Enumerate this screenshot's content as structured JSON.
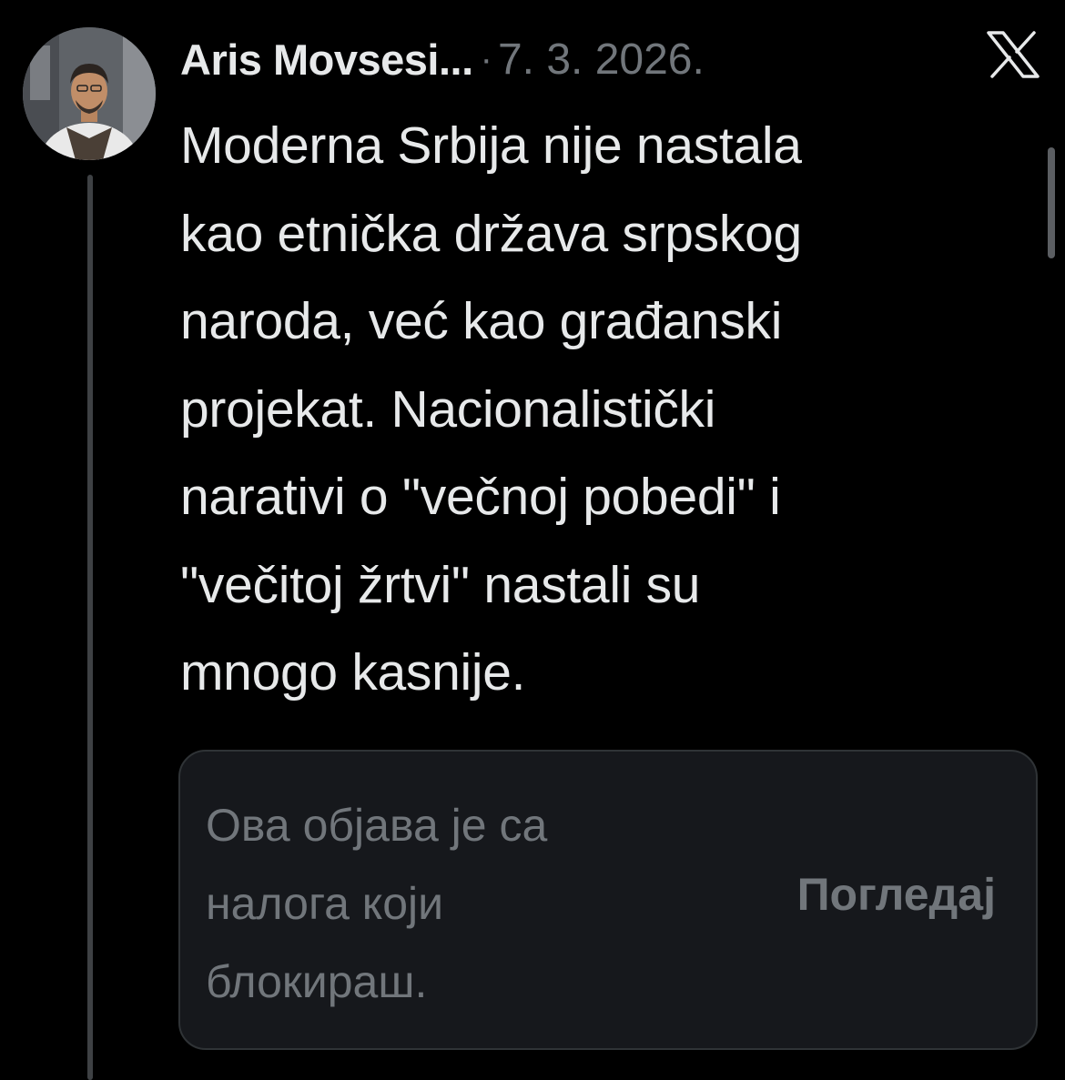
{
  "tweet": {
    "author": "Aris Movsesi...",
    "separator": "·",
    "date": "7. 3. 2026.",
    "text": "Moderna Srbija nije nastala\nkao etnička država srpskog\nnaroda, već kao građanski\nprojekat. Nacionalistički\nnarativi o \"večnoj pobedi\" i\n\"večitoj žrtvi\" nastali su\nmnogo kasnije.",
    "platform_icon": "x-logo-icon",
    "avatar_icon": "profile-photo"
  },
  "blocked_notice": {
    "text": "Ова објава је са\nналога који\nблокираш.",
    "button_label": "Погледај"
  },
  "colors": {
    "background": "#000000",
    "primary_text": "#e7e9ea",
    "secondary_text": "#71767b",
    "card_background": "#16181c",
    "card_border": "#2f3336",
    "thread_line": "#3e4144"
  }
}
